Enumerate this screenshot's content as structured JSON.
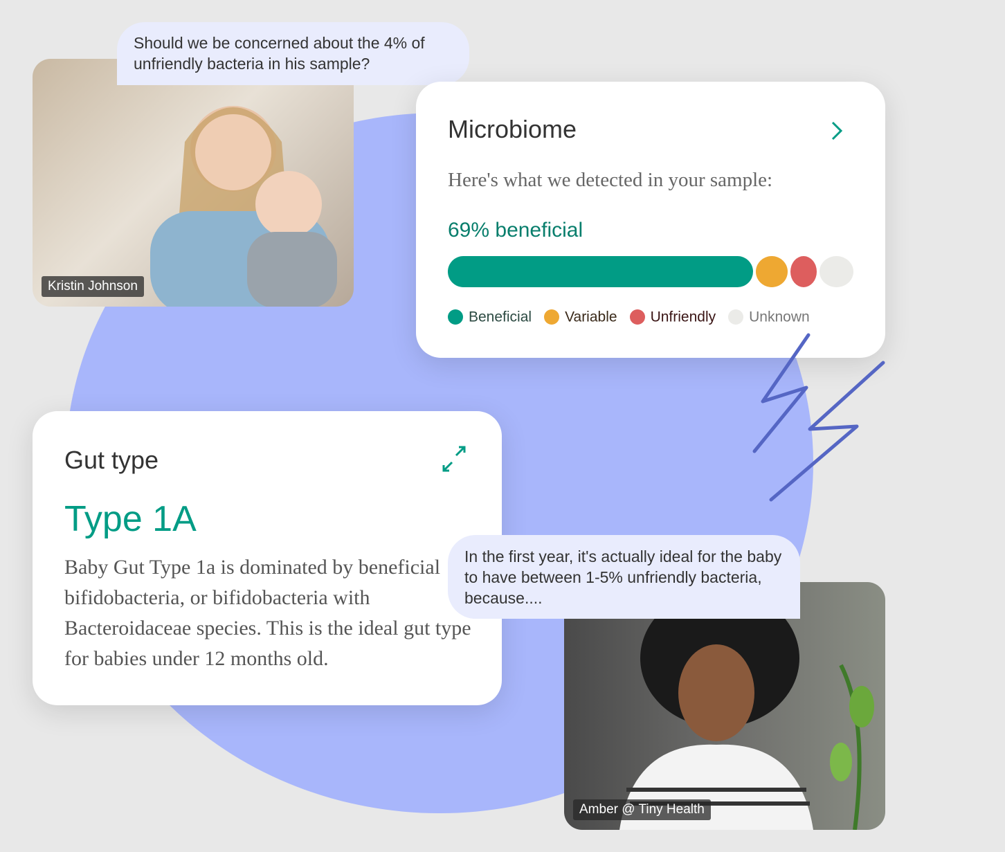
{
  "bubbles": {
    "question": "Should we be concerned about the 4% of unfriendly bacteria in his sample?",
    "answer": "In the first year, it's actually ideal for the baby to have between 1-5% unfriendly bacteria, because...."
  },
  "participants": [
    {
      "name": "Kristin Johnson"
    },
    {
      "name": "Amber @ Tiny Health"
    }
  ],
  "microbiome": {
    "title": "Microbiome",
    "subtitle": "Here's what we detected in your sample:",
    "headline": "69% beneficial",
    "composition": {
      "beneficial_percent": 69
    },
    "legend": [
      {
        "label": "Beneficial",
        "color": "#019c85"
      },
      {
        "label": "Variable",
        "color": "#eea832"
      },
      {
        "label": "Unfriendly",
        "color": "#dd5e5e"
      },
      {
        "label": "Unknown",
        "color": "#ebebe8"
      }
    ]
  },
  "gut_type": {
    "title": "Gut type",
    "value": "Type 1A",
    "description": "Baby Gut Type 1a is dominated by beneficial bifidobacteria, or bifidobacteria with Bacteroidaceae species. This is the ideal gut type for babies under 12 months old."
  },
  "colors": {
    "accent": "#019c85",
    "background_blob": "#a8b6fb",
    "scribble": "#5566c4"
  }
}
